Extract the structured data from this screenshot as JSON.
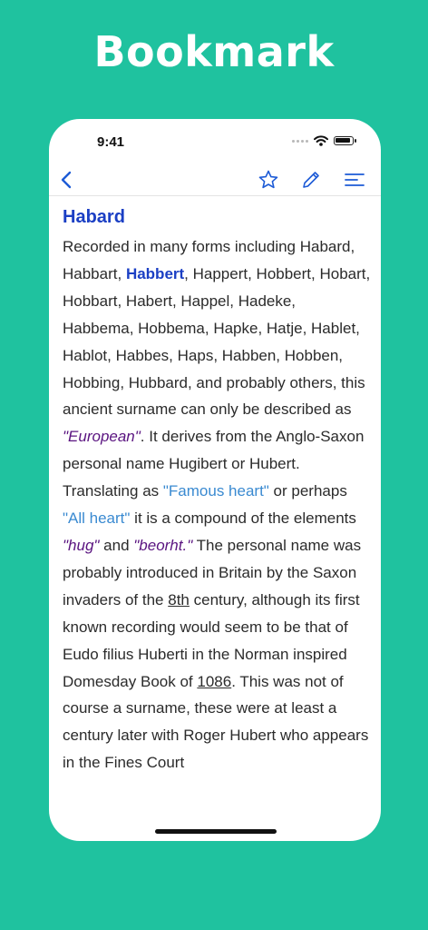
{
  "hero": {
    "title": "Bookmark"
  },
  "status_bar": {
    "time": "9:41"
  },
  "nav": {
    "back_icon": "chevron-left-icon",
    "bookmark_icon": "star-icon",
    "edit_icon": "pencil-icon",
    "menu_icon": "menu-lines-icon"
  },
  "entry": {
    "title": "Habard",
    "segments": {
      "s1": "Recorded in many forms including Habard, Habbart, ",
      "s2": "Habbert",
      "s3": ", Happert, Hobbert, Hobart, Hobbart, Habert, Happel, Hadeke, Habbema, Hobbema, Hapke, Hatje, Hablet, Hablot, Habbes, Haps, Habben, Hobben, Hobbing, Hubbard, and probably others, this ancient surname can only be described as ",
      "s4": "\"European\"",
      "s5": ". It derives from the Anglo-Saxon personal name Hugibert or Hubert. Translating as ",
      "s6": "\"Famous heart\"",
      "s7": " or perhaps ",
      "s8": "\"All heart\"",
      "s9": " it is a compound of the elements ",
      "s10": "\"hug\"",
      "s11": " and ",
      "s12": "\"beorht.\"",
      "s13": " The personal name was probably introduced in Britain by the Saxon invaders of the ",
      "s14": "8th",
      "s15": " century, although its first known recording would seem to be that of Eudo filius Huberti in the Norman inspired Domesday Book of ",
      "s16": "1086",
      "s17": ". This was not of course a surname, these were at least a century later with Roger Hubert who appears in the Fines Court"
    }
  },
  "colors": {
    "background": "#1fc29f",
    "title_blue": "#1b3fc4",
    "link_blue": "#3a8ad1",
    "italic_purple": "#5a1480"
  }
}
